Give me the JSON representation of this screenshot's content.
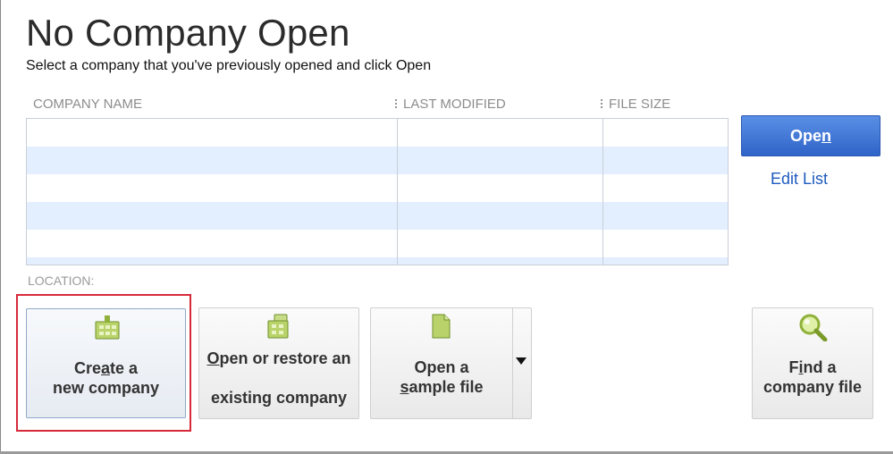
{
  "header": {
    "title": "No Company Open",
    "subtitle": "Select a company that you've previously opened and click Open"
  },
  "table": {
    "columns": [
      "COMPANY NAME",
      "LAST MODIFIED",
      "FILE SIZE"
    ],
    "rows": []
  },
  "actions": {
    "open_label_pre": "Ope",
    "open_label_mnemonic": "n",
    "edit_list": "Edit List"
  },
  "location": {
    "label": "LOCATION:"
  },
  "tiles": {
    "create": {
      "line1_pre": "Cre",
      "line1_mn": "a",
      "line1_post": "te a",
      "line2": "new company",
      "icon": "new-company-icon"
    },
    "restore": {
      "line1_pre": "",
      "line1_mn": "O",
      "line1_post": "pen or restore an",
      "line2": "existing company",
      "icon": "restore-company-icon"
    },
    "sample": {
      "line1": "Open a",
      "line2_mn": "s",
      "line2_post": "ample file",
      "icon": "sample-file-icon"
    },
    "find": {
      "line1_pre": "F",
      "line1_mn": "i",
      "line1_post": "nd a",
      "line2": "company file",
      "icon": "magnifier-icon"
    }
  },
  "colors": {
    "accent": "#2f64c8",
    "row_alt": "#e3efff",
    "highlight": "#d62a3a"
  }
}
